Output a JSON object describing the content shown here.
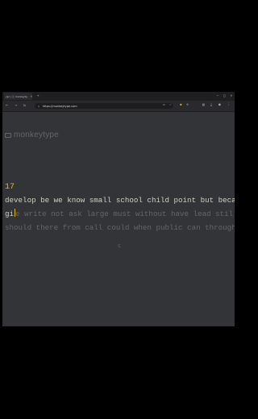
{
  "browser": {
    "tab_title": "ypr | ⓘ monkeyty...",
    "tab_close": "×",
    "new_tab": "+",
    "url": "https://monkeytype.com",
    "nav_icons": [
      "back-icon",
      "forward-icon",
      "reload-icon"
    ],
    "window_controls": [
      "–",
      "□",
      "×"
    ]
  },
  "app": {
    "logo": "monkeytype",
    "word_counter": "17",
    "typed_line1": "develop be we know small school child point but because face back",
    "typed_line2_start": "gi",
    "untyped_line2_a": "e",
    "untyped_line2_b": " write not ask large must without have lead still without she",
    "untyped_line3": "should there from call could when public can through now into",
    "restart_glyph": "c"
  },
  "colors": {
    "background": "#323437",
    "main_text": "#d1d0c5",
    "sub_text": "#646669",
    "accent": "#e2b714"
  }
}
